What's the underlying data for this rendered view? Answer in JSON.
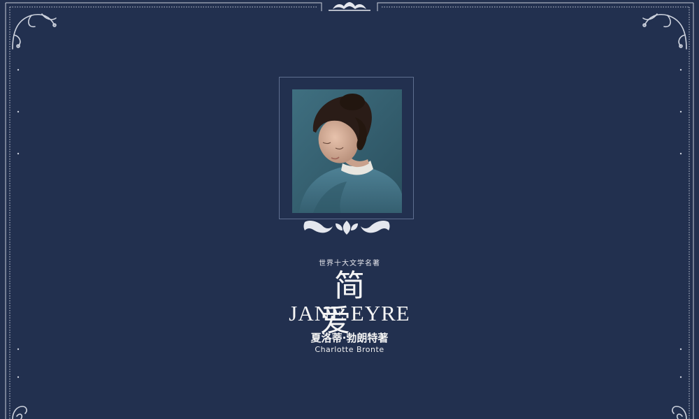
{
  "book": {
    "series": "世界十大文学名著",
    "title_cn": "简 爱",
    "title_en": "JANE EYRE",
    "author_cn": "夏洛蒂·勃朗特著",
    "author_en": "Charlotte Bronte"
  },
  "colors": {
    "background": "#22304f",
    "ornament": "#d9dde6",
    "text": "#f5f5f5"
  },
  "icons": [
    "corner-flourish-icon",
    "top-ornament-icon",
    "bottom-flourish-icon"
  ]
}
